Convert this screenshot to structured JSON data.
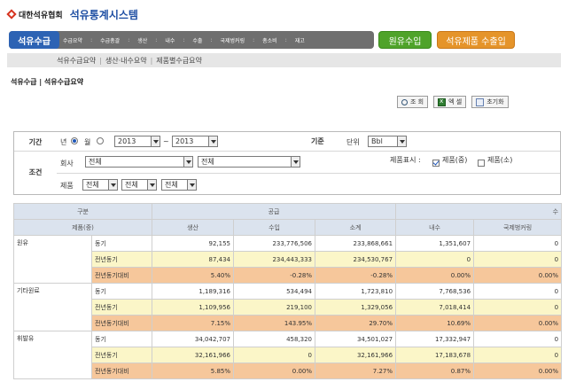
{
  "header": {
    "org_name": "대한석유협회",
    "system_title": "석유통계시스템",
    "logo_icon": "diamond-logo-icon"
  },
  "nav": {
    "active": "석유수급",
    "items": [
      "수급요약",
      "수급총괄",
      "생산",
      "내수",
      "수출",
      "국제벙커링",
      "총소비",
      "재고"
    ],
    "separator": ":",
    "green_button": "원유수입",
    "orange_button": "석유제품 수출입",
    "colors": {
      "active": "#2d63b4",
      "main": "#6f6f6f",
      "green": "#4fa32a",
      "orange": "#e5942a"
    }
  },
  "subnav": {
    "items": [
      "석유수급요약",
      "생산·내수요약",
      "제품별수급요약"
    ],
    "separator": "|"
  },
  "breadcrumb": {
    "text": "석유수급 | 석유수급요약"
  },
  "toolbar": {
    "search": "조 회",
    "excel": "엑 셀",
    "reset": "초기화"
  },
  "filter": {
    "period_label": "기간",
    "year_radio": "년",
    "month_radio": "월",
    "from_year": "2013",
    "tilde": "~",
    "to_year": "2013",
    "basis_label": "기준",
    "unit_label": "단위",
    "unit_value": "Bbl",
    "condition_label": "조건",
    "company_label": "회사",
    "company_value": "전체",
    "company_value2": "전체",
    "display_label": "제품표시 :",
    "display_mid": "제품(중)",
    "display_small": "제품(소)",
    "product_label": "제품",
    "product_values": [
      "전체",
      "전체",
      "전체"
    ]
  },
  "grid": {
    "top_left": "구분",
    "supply_group": "공급",
    "demand_group": "수",
    "sub_left": "제품(중)",
    "columns": [
      "생산",
      "수입",
      "소계",
      "내수",
      "국제벙커링"
    ],
    "groups": [
      {
        "name": "원유",
        "rows": [
          {
            "label": "동기",
            "values": [
              "92,155",
              "233,776,506",
              "233,868,661",
              "1,351,607",
              "0"
            ]
          },
          {
            "label": "전년동기",
            "values": [
              "87,434",
              "234,443,333",
              "234,530,767",
              "0",
              "0"
            ]
          },
          {
            "label": "전년동기대비",
            "values": [
              "5.40%",
              "-0.28%",
              "-0.28%",
              "0.00%",
              "0.00%"
            ]
          }
        ]
      },
      {
        "name": "기타원료",
        "rows": [
          {
            "label": "동기",
            "values": [
              "1,189,316",
              "534,494",
              "1,723,810",
              "7,768,536",
              "0"
            ]
          },
          {
            "label": "전년동기",
            "values": [
              "1,109,956",
              "219,100",
              "1,329,056",
              "7,018,414",
              "0"
            ]
          },
          {
            "label": "전년동기대비",
            "values": [
              "7.15%",
              "143.95%",
              "29.70%",
              "10.69%",
              "0.00%"
            ]
          }
        ]
      },
      {
        "name": "휘발유",
        "rows": [
          {
            "label": "동기",
            "values": [
              "34,042,707",
              "458,320",
              "34,501,027",
              "17,332,947",
              "0"
            ]
          },
          {
            "label": "전년동기",
            "values": [
              "32,161,966",
              "0",
              "32,161,966",
              "17,183,678",
              "0"
            ]
          },
          {
            "label": "전년동기대비",
            "values": [
              "5.85%",
              "0.00%",
              "7.27%",
              "0.87%",
              "0.00%"
            ]
          }
        ]
      }
    ]
  }
}
